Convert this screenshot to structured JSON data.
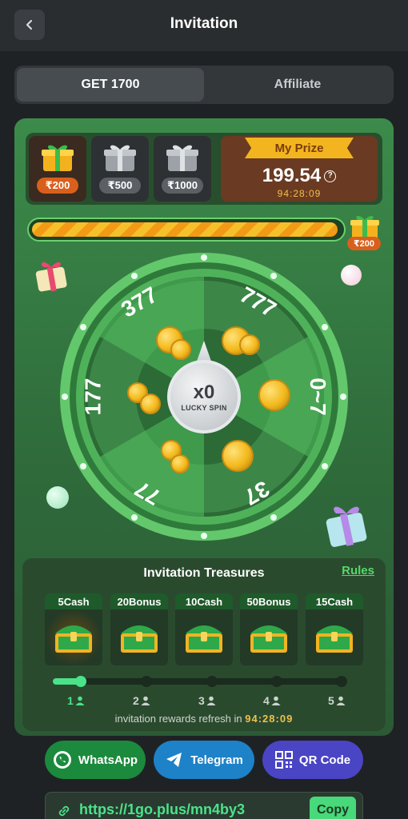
{
  "header": {
    "title": "Invitation"
  },
  "tabs": [
    {
      "label": "GET 1700"
    },
    {
      "label": "Affiliate"
    }
  ],
  "tiers": [
    {
      "amount": "₹200"
    },
    {
      "amount": "₹500"
    },
    {
      "amount": "₹1000"
    }
  ],
  "prize": {
    "label": "My Prize",
    "value": "199.54",
    "help": "?",
    "timer": "94:28:09"
  },
  "progress": {
    "fraction": 0.99,
    "goal_badge": "₹200"
  },
  "wheel": {
    "segments": [
      "377",
      "777",
      "0~7",
      "37",
      "77",
      "177"
    ],
    "multiplier": "x0",
    "center_label": "LUCKY SPIN"
  },
  "treasures": {
    "title": "Invitation Treasures",
    "rules_label": "Rules",
    "chests": [
      {
        "label": "5Cash"
      },
      {
        "label": "20Bonus"
      },
      {
        "label": "10Cash"
      },
      {
        "label": "50Bonus"
      },
      {
        "label": "15Cash"
      }
    ],
    "steps": [
      "1",
      "2",
      "3",
      "4",
      "5"
    ],
    "progress_fraction": 0.1,
    "refresh_prefix": "invitation rewards refresh in",
    "refresh_timer": "94:28:09"
  },
  "share": {
    "whatsapp": "WhatsApp",
    "telegram": "Telegram",
    "qr": "QR Code"
  },
  "invite_link": {
    "url": "https://1go.plus/mn4by3",
    "copy_label": "Copy"
  },
  "colors": {
    "accent": "#4ae38a",
    "gold": "#f2b51f",
    "panel_green": "#3c8b4b"
  }
}
